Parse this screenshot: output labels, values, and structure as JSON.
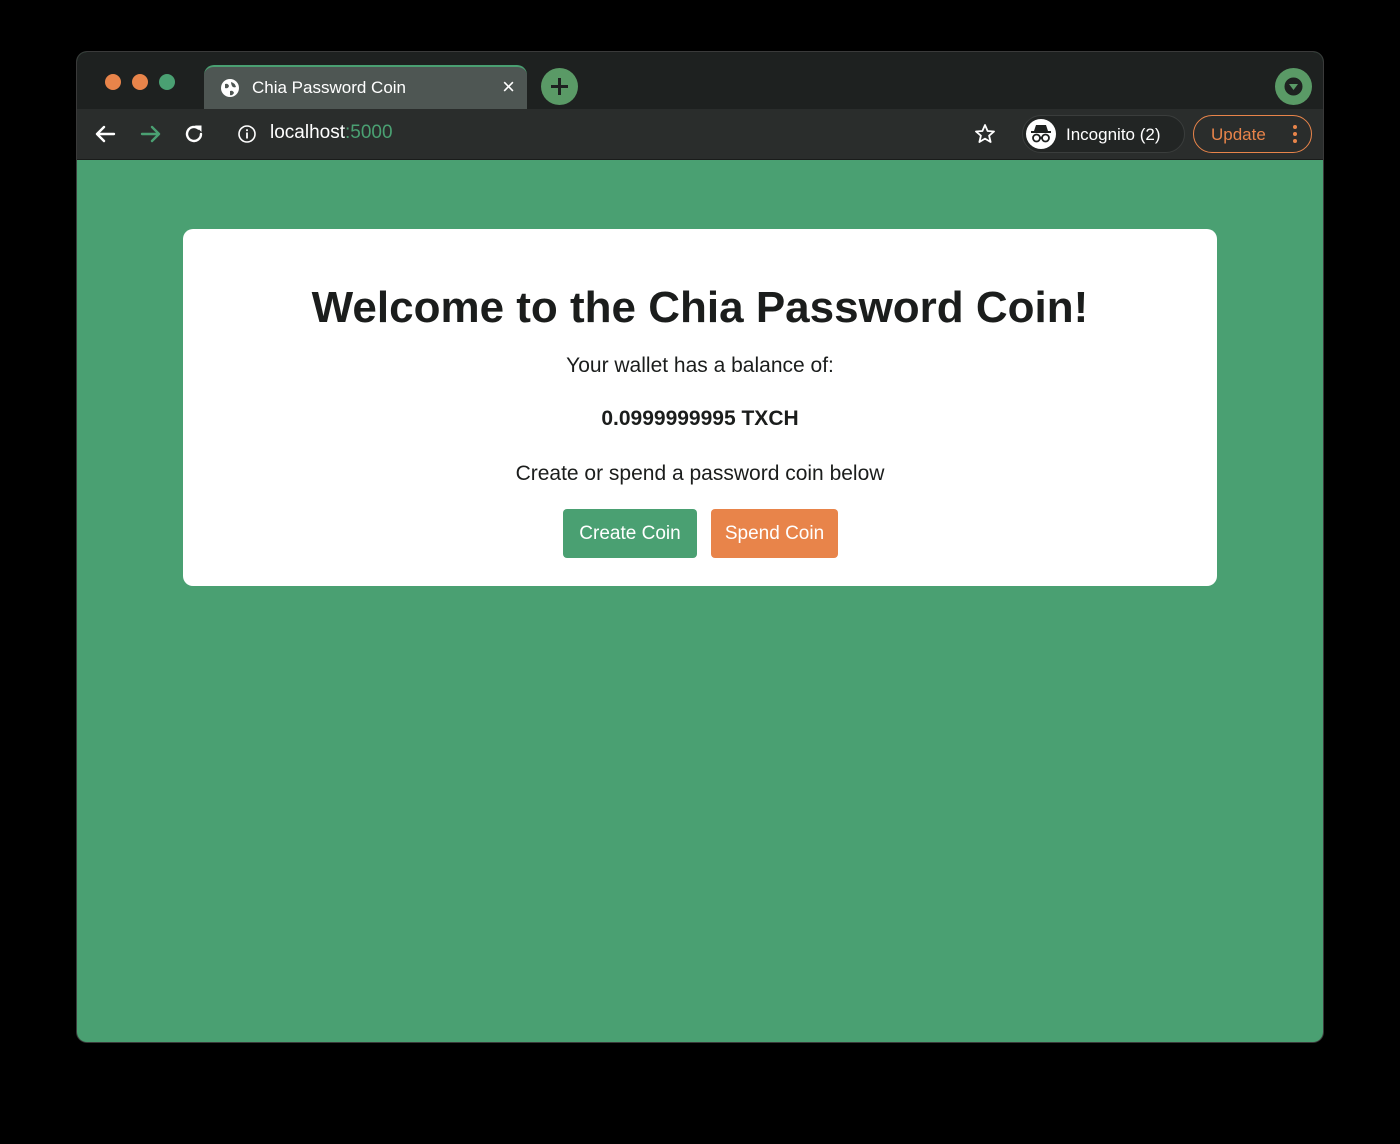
{
  "browser": {
    "tab": {
      "title": "Chia Password Coin",
      "close_glyph": "×",
      "icon": "globe-icon"
    },
    "address": {
      "host": "localhost",
      "port": ":5000"
    },
    "incognito_label": "Incognito (2)",
    "update_label": "Update"
  },
  "page": {
    "heading": "Welcome to the Chia Password Coin!",
    "balance_label": "Your wallet has a balance of:",
    "balance_value": "0.0999999995 TXCH",
    "prompt": "Create or spend a password coin below",
    "create_button": "Create Coin",
    "spend_button": "Spend Coin"
  },
  "colors": {
    "background": "#4aa072",
    "accent_green": "#4aa072",
    "accent_orange": "#e8844a",
    "card": "#ffffff"
  }
}
